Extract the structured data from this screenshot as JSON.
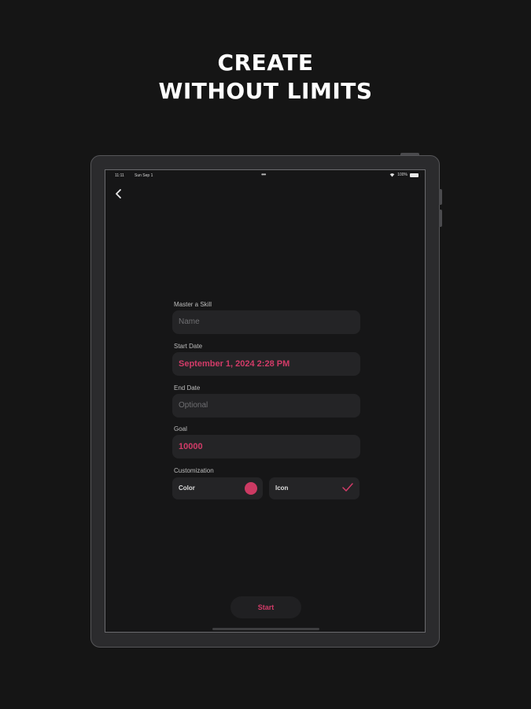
{
  "headline": {
    "line1": "CREATE",
    "line2": "WITHOUT LIMITS"
  },
  "status_bar": {
    "time": "11:11",
    "date": "Sun Sep 1",
    "battery": "100%"
  },
  "form": {
    "skill_label": "Master a Skill",
    "name_placeholder": "Name",
    "start_label": "Start Date",
    "start_value": "September 1, 2024 2:28 PM",
    "end_label": "End Date",
    "end_placeholder": "Optional",
    "goal_label": "Goal",
    "goal_value": "10000",
    "custom_label": "Customization",
    "color_label": "Color",
    "icon_label": "Icon",
    "start_button": "Start"
  },
  "colors": {
    "accent": "#d23b68",
    "background": "#151515",
    "field": "#242426"
  },
  "icons": [
    "chevron-left-icon",
    "wifi-icon",
    "battery-icon",
    "checkmark-icon"
  ]
}
